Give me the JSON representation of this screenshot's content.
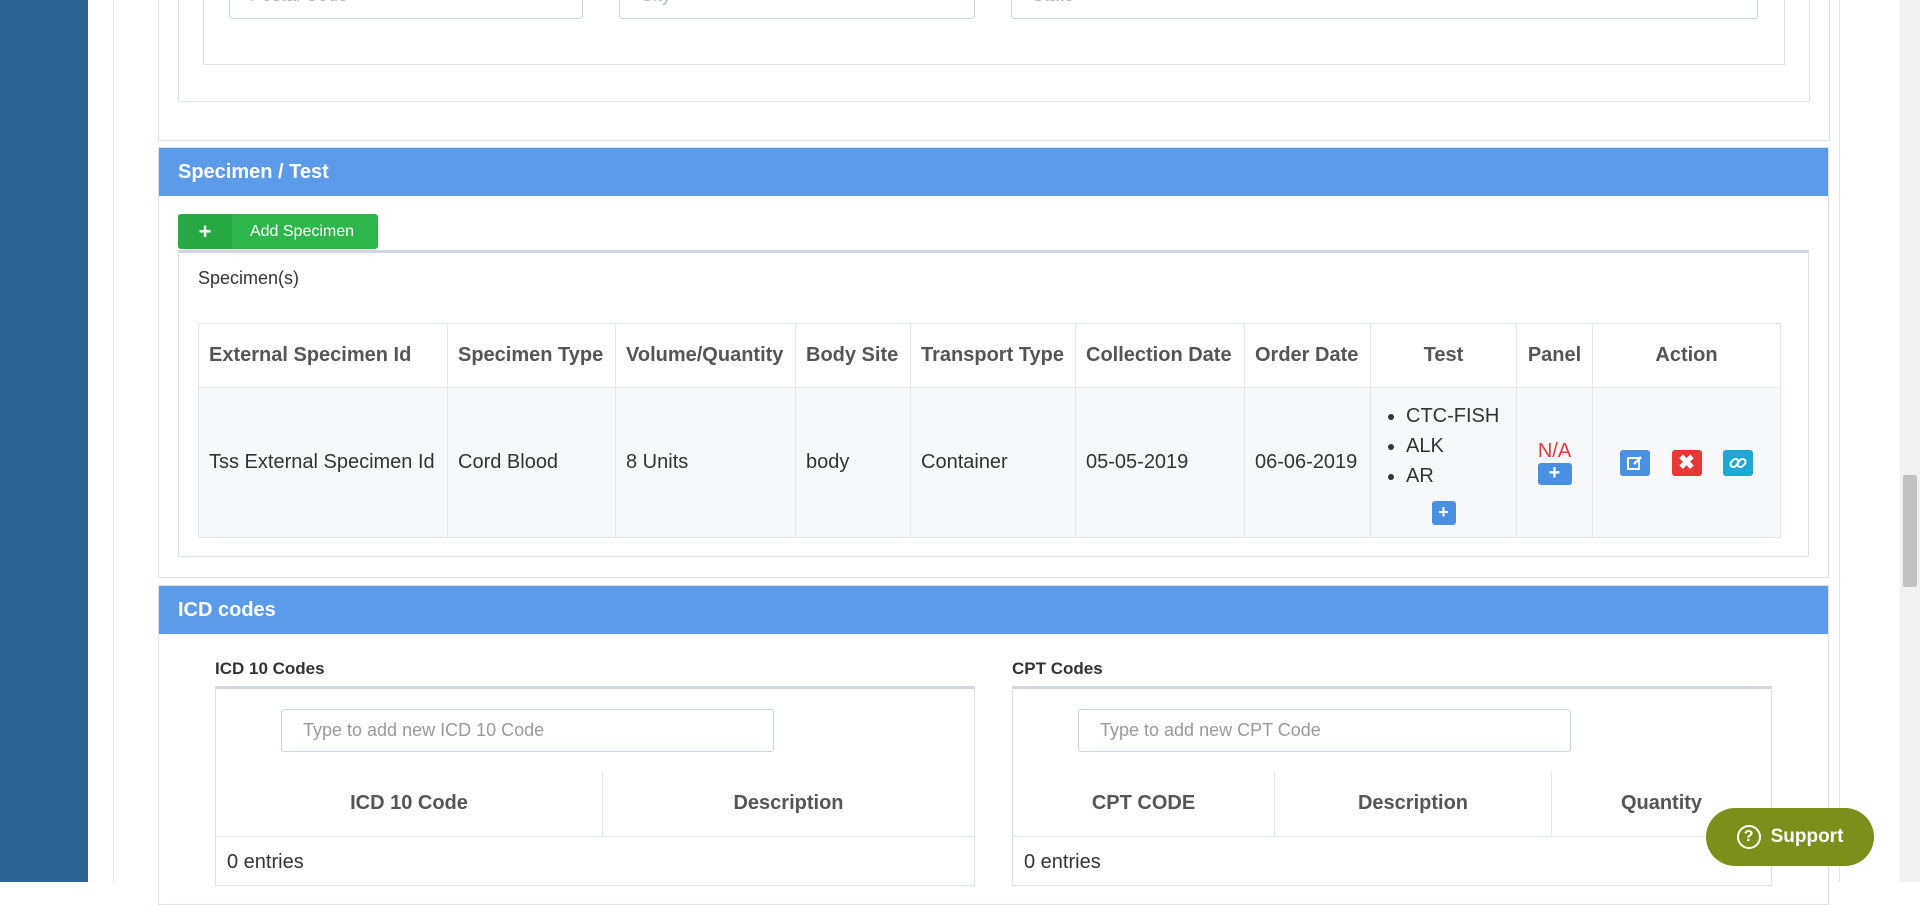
{
  "address": {
    "postal_placeholder": "Postal Code",
    "city_placeholder": "City",
    "state_placeholder": "State"
  },
  "specimen_section": {
    "title": "Specimen / Test",
    "add_button_icon": "plus-icon",
    "add_button_label": "Add Specimen",
    "list_title": "Specimen(s)",
    "columns": [
      "External Specimen Id",
      "Specimen Type",
      "Volume/Quantity",
      "Body Site",
      "Transport Type",
      "Collection Date",
      "Order Date",
      "Test",
      "Panel",
      "Action"
    ],
    "rows": [
      {
        "external_id": "Tss External Specimen Id",
        "type": "Cord Blood",
        "volume": "8 Units",
        "body_site": "body",
        "transport": "Container",
        "collection_date": "05-05-2019",
        "order_date": "06-06-2019",
        "tests": [
          "CTC-FISH",
          "ALK",
          "AR"
        ],
        "panel": "N/A",
        "actions": [
          "edit-icon",
          "delete-icon",
          "link-icon"
        ]
      }
    ]
  },
  "icd_section": {
    "title": "ICD codes",
    "icd": {
      "label": "ICD 10 Codes",
      "placeholder": "Type to add new ICD 10 Code",
      "columns": [
        "ICD 10 Code",
        "Description"
      ],
      "entries": "0 entries"
    },
    "cpt": {
      "label": "CPT Codes",
      "placeholder": "Type to add new CPT Code",
      "columns": [
        "CPT CODE",
        "Description",
        "Quantity"
      ],
      "entries": "0 entries"
    }
  },
  "support": {
    "label": "Support",
    "icon": "question-circle-icon"
  },
  "colors": {
    "sidebar": "#2d6495",
    "section_header": "#5b9bea",
    "add_button": "#2db74a",
    "na_text": "#e9373f",
    "edit": "#4a90e2",
    "delete": "#e53935",
    "link": "#1fa7d6",
    "support": "#7d8f1b"
  }
}
